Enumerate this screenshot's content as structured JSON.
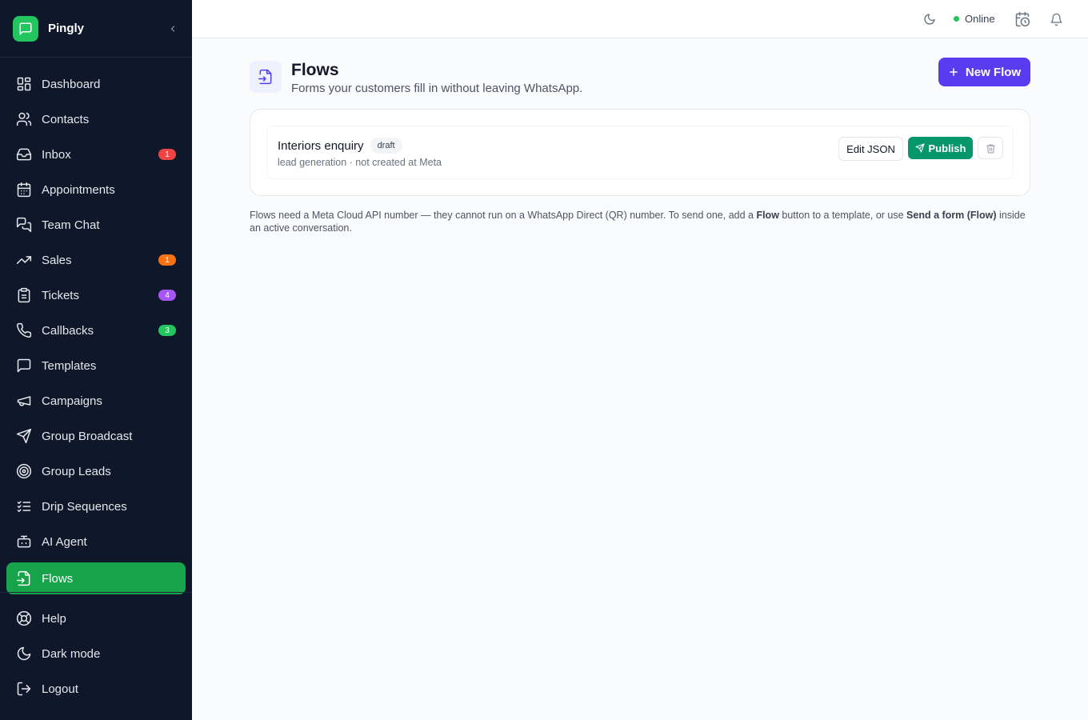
{
  "brand": {
    "name": "Pingly"
  },
  "sidebar": {
    "items": [
      {
        "label": "Dashboard",
        "icon": "dashboard-icon"
      },
      {
        "label": "Contacts",
        "icon": "users-icon"
      },
      {
        "label": "Inbox",
        "icon": "inbox-icon",
        "badge": "1",
        "badge_color": "#ef4444"
      },
      {
        "label": "Appointments",
        "icon": "calendar-icon"
      },
      {
        "label": "Team Chat",
        "icon": "team-chat-icon"
      },
      {
        "label": "Sales",
        "icon": "trending-up-icon",
        "badge": "1",
        "badge_color": "#f97316"
      },
      {
        "label": "Tickets",
        "icon": "clipboard-icon",
        "badge": "4",
        "badge_color": "#a855f7"
      },
      {
        "label": "Callbacks",
        "icon": "phone-icon",
        "badge": "3",
        "badge_color": "#22c55e"
      },
      {
        "label": "Templates",
        "icon": "message-square-icon"
      },
      {
        "label": "Campaigns",
        "icon": "megaphone-icon"
      },
      {
        "label": "Group Broadcast",
        "icon": "send-icon"
      },
      {
        "label": "Group Leads",
        "icon": "target-icon"
      },
      {
        "label": "Drip Sequences",
        "icon": "list-checks-icon"
      },
      {
        "label": "AI Agent",
        "icon": "bot-icon"
      },
      {
        "label": "Flows",
        "icon": "file-input-icon",
        "active": true
      }
    ],
    "bottom": [
      {
        "label": "Help",
        "icon": "lifebuoy-icon"
      },
      {
        "label": "Dark mode",
        "icon": "moon-icon"
      },
      {
        "label": "Logout",
        "icon": "logout-icon"
      }
    ]
  },
  "topbar": {
    "status": "Online",
    "status_color": "#22c55e"
  },
  "page": {
    "title": "Flows",
    "subtitle": "Forms your customers fill in without leaving WhatsApp.",
    "new_button": "New Flow",
    "accent": "#5a3cf0"
  },
  "flows": [
    {
      "name": "Interiors enquiry",
      "status": "draft",
      "meta": "lead generation · not created at Meta",
      "edit_label": "Edit JSON",
      "publish_label": "Publish"
    }
  ],
  "note": {
    "part1": "Flows need a Meta Cloud API number — they cannot run on a WhatsApp Direct (QR) number. To send one, add a ",
    "bold1": "Flow",
    "part2": " button to a template, or use ",
    "bold2": "Send a form (Flow)",
    "part3": " inside an active conversation."
  }
}
